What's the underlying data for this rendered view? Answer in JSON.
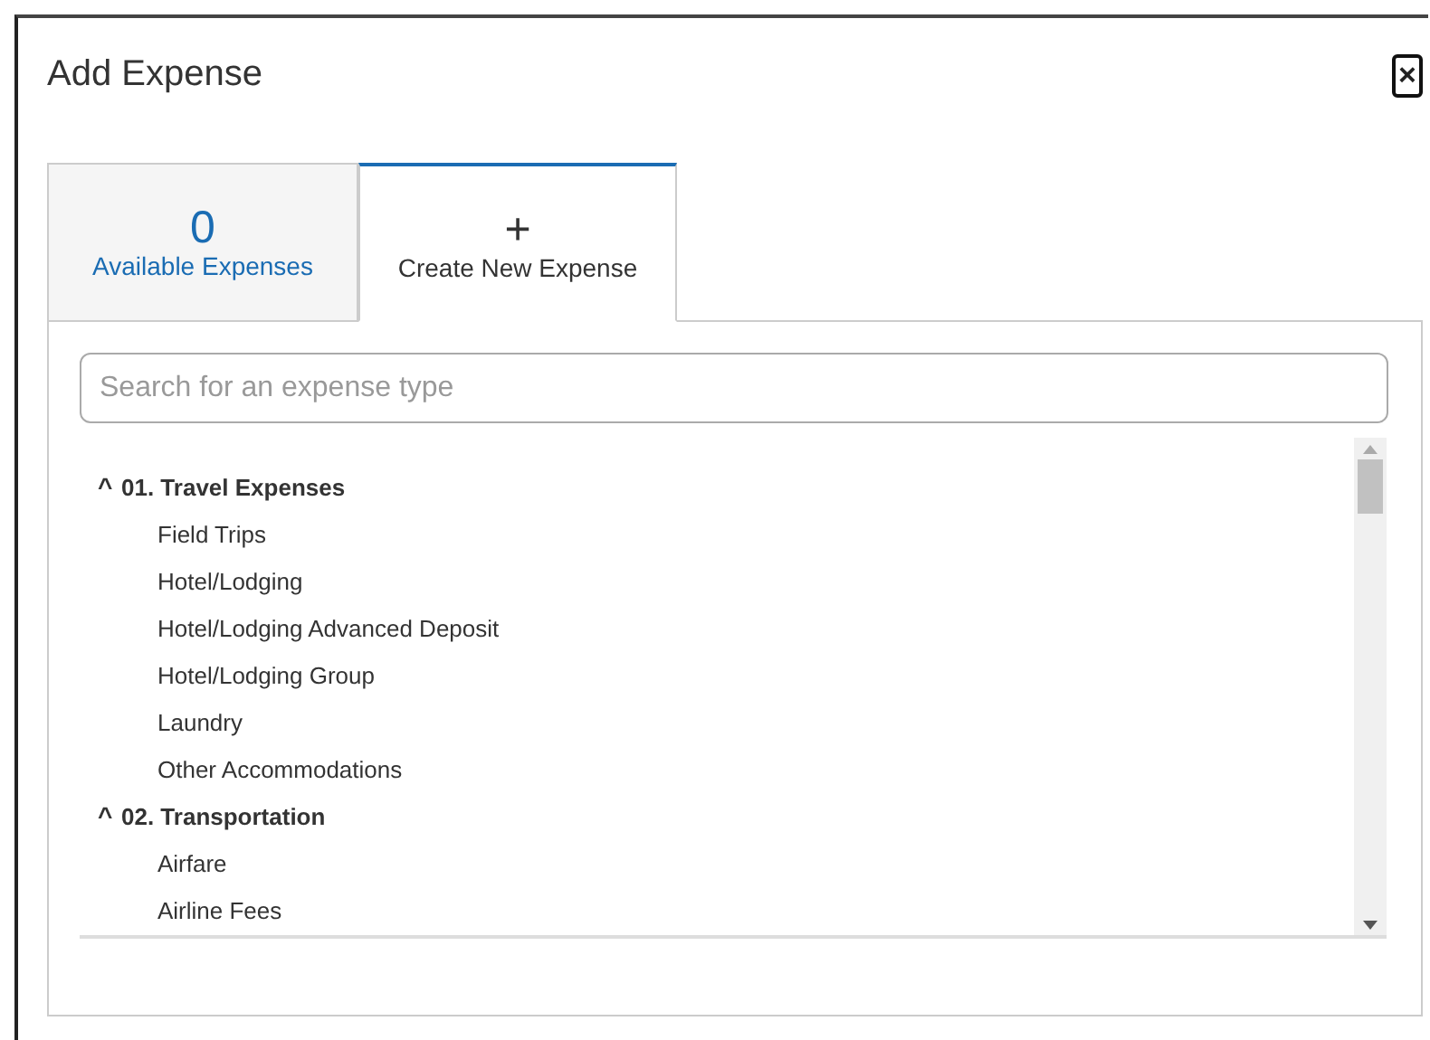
{
  "dialog": {
    "title": "Add Expense",
    "close_icon": "×"
  },
  "tabs": [
    {
      "kind": "count",
      "count": "0",
      "label": "Available Expenses",
      "selected": false
    },
    {
      "kind": "icon",
      "icon": "+",
      "label": "Create New Expense",
      "selected": true
    }
  ],
  "search": {
    "placeholder": "Search for an expense type"
  },
  "expense_types": [
    {
      "label": "01. Travel Expenses",
      "caret": "^",
      "expanded": true,
      "children": [
        {
          "label": "Field Trips"
        },
        {
          "label": "Hotel/Lodging"
        },
        {
          "label": "Hotel/Lodging Advanced Deposit"
        },
        {
          "label": "Hotel/Lodging Group"
        },
        {
          "label": "Laundry"
        },
        {
          "label": "Other Accommodations"
        }
      ]
    },
    {
      "label": "02. Transportation",
      "caret": "^",
      "expanded": true,
      "children": [
        {
          "label": "Airfare"
        },
        {
          "label": "Airline Fees"
        }
      ]
    }
  ]
}
